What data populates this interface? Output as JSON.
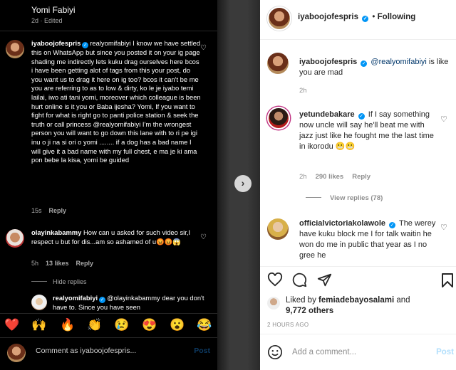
{
  "left_panel": {
    "header": {
      "name": "Yomi Fabiyi",
      "meta": "2d · Edited"
    },
    "comments": [
      {
        "username": "iyaboojofespris",
        "verified": true,
        "text": "realyomifabiyi I know we have settled this on WhatsApp but since you posted it on your ig page shading me indirectly lets kuku drag ourselves here bcos i have been getting alot of tags from this your post, do you want us to drag it here on ig too? bcos it can't be me you are referring to as to low & dirty, ko le je iyabo temi lailai, iwo ati tani yomi, moreover which colleague is been hurt online is it you or Baba ijesha? Yomi, If you want to fight for what is right go to panti police station & seek the truth or call princess @realyomifabiyi I'm the wrongest person you will want to go down this lane with to ri pe igi inu o ji na si ori o yomi ........ if a dog has a bad name I will give it a bad name with my full chest, e ma je ki ama pon bebe la kisa, yomi be guided",
        "time": "15s",
        "reply": "Reply"
      },
      {
        "username": "olayinkabammy",
        "text": "How can u asked for such video sir,I respect u but for dis...am so ashamed of u😡😡😱",
        "time": "5h",
        "likes": "13 likes",
        "reply": "Reply"
      },
      {
        "username": "realyomifabiyi",
        "verified": true,
        "text": "@olayinkabammy dear you don't have to. Since you have seen"
      }
    ],
    "hide_replies": "Hide replies",
    "emoji_bar": [
      "❤️",
      "🙌",
      "🔥",
      "👏",
      "😢",
      "😍",
      "😮",
      "😂"
    ],
    "comment_input": {
      "placeholder": "Comment as iyaboojofespris...",
      "post": "Post"
    }
  },
  "right_panel": {
    "header": {
      "username": "iyaboojofespris",
      "separator": "•",
      "follow_state": "Following"
    },
    "caption": {
      "username": "iyaboojofespris",
      "mention": "@realyomifabiyi",
      "text": " is like you are mad",
      "time": "2h"
    },
    "comments": [
      {
        "username": "yetundebakare",
        "verified": true,
        "text": "If I say something now uncle will say he'll beat me with jazz just like he fought me the last time in ikorodu 😬😬",
        "time": "2h",
        "likes": "290 likes",
        "reply": "Reply",
        "view_replies": "View replies (78)"
      },
      {
        "username": "officialvictoriakolawole",
        "verified": true,
        "text": "The werey have kuku block me I for talk waitin he won do me in public that year as I no gree he"
      }
    ],
    "likes": {
      "prefix": "Liked by ",
      "user": "femiadebayosalami",
      "and": " and",
      "count": "9,772 others"
    },
    "time_ago": "2 HOURS AGO",
    "add_comment": {
      "placeholder": "Add a comment...",
      "post": "Post"
    }
  },
  "colors": {
    "verified": "#0095f6",
    "mention": "#00376b",
    "muted": "#8e8e8e"
  }
}
